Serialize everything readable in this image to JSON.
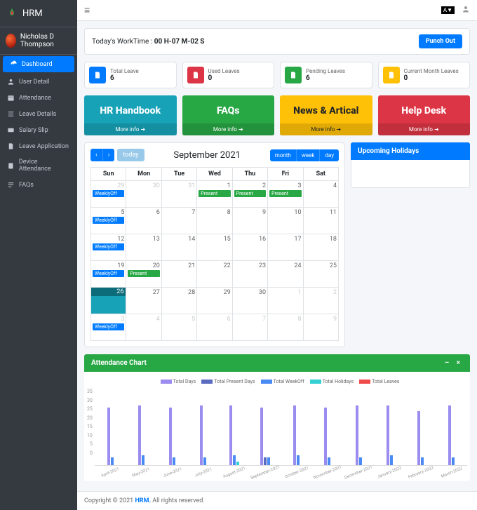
{
  "brand": "HRM",
  "user": {
    "name": "Nicholas D Thompson"
  },
  "nav": [
    {
      "label": "Dashboard",
      "icon": "gauge",
      "active": true
    },
    {
      "label": "User Detail",
      "icon": "user"
    },
    {
      "label": "Attendance",
      "icon": "calendar"
    },
    {
      "label": "Leave Details",
      "icon": "list"
    },
    {
      "label": "Salary Slip",
      "icon": "card"
    },
    {
      "label": "Leave Application",
      "icon": "doc"
    },
    {
      "label": "Device Attendance",
      "icon": "device"
    },
    {
      "label": "FAQs",
      "icon": "faq"
    }
  ],
  "topbar": {
    "menu": "≡",
    "lang": "A▼",
    "user_icon": "👤"
  },
  "worktime": {
    "label": "Today's WorkTime : ",
    "value": "00 H-07 M-02 S",
    "punch": "Punch Out"
  },
  "stats": [
    {
      "title": "Total Leave",
      "value": "6",
      "color": "#007bff"
    },
    {
      "title": "Used Leaves",
      "value": "0",
      "color": "#dc3545"
    },
    {
      "title": "Pending Leaves",
      "value": "6",
      "color": "#28a745"
    },
    {
      "title": "Current Month Leaves",
      "value": "0",
      "color": "#ffc107"
    }
  ],
  "cards": [
    {
      "title": "HR Handbook",
      "more": "More info"
    },
    {
      "title": "FAQs",
      "more": "More info"
    },
    {
      "title": "News & Artical",
      "more": "More info"
    },
    {
      "title": "Help Desk",
      "more": "More info"
    }
  ],
  "calendar": {
    "prev": "‹",
    "next": "›",
    "today": "today",
    "title": "September 2021",
    "views": {
      "month": "month",
      "week": "week",
      "day": "day"
    },
    "days": [
      "Sun",
      "Mon",
      "Tue",
      "Wed",
      "Thu",
      "Fri",
      "Sat"
    ],
    "events": {
      "wo": "WeeklyOff",
      "pr": "Present"
    },
    "grid": [
      [
        {
          "n": 29,
          "o": 1,
          "e": [
            "wo"
          ]
        },
        {
          "n": 30,
          "o": 1
        },
        {
          "n": 31,
          "o": 1
        },
        {
          "n": 1,
          "e": [
            "pr"
          ]
        },
        {
          "n": 2,
          "e": [
            "pr"
          ]
        },
        {
          "n": 3,
          "e": [
            "pr"
          ]
        },
        {
          "n": 4
        }
      ],
      [
        {
          "n": 5,
          "e": [
            "wo"
          ]
        },
        {
          "n": 6
        },
        {
          "n": 7
        },
        {
          "n": 8
        },
        {
          "n": 9
        },
        {
          "n": 10
        },
        {
          "n": 11
        }
      ],
      [
        {
          "n": 12,
          "e": [
            "wo"
          ]
        },
        {
          "n": 13
        },
        {
          "n": 14
        },
        {
          "n": 15
        },
        {
          "n": 16
        },
        {
          "n": 17
        },
        {
          "n": 18
        }
      ],
      [
        {
          "n": 19,
          "e": [
            "wo"
          ]
        },
        {
          "n": 20,
          "e": [
            "pr"
          ]
        },
        {
          "n": 21
        },
        {
          "n": 22
        },
        {
          "n": 23
        },
        {
          "n": 24
        },
        {
          "n": 25
        }
      ],
      [
        {
          "n": 26,
          "t": 1
        },
        {
          "n": 27
        },
        {
          "n": 28
        },
        {
          "n": 29
        },
        {
          "n": 30
        },
        {
          "n": 1,
          "o": 1
        },
        {
          "n": 2,
          "o": 1
        }
      ],
      [
        {
          "n": 3,
          "o": 1,
          "e": [
            "wo"
          ]
        },
        {
          "n": 4,
          "o": 1
        },
        {
          "n": 5,
          "o": 1
        },
        {
          "n": 6,
          "o": 1
        },
        {
          "n": 7,
          "o": 1
        },
        {
          "n": 8,
          "o": 1
        },
        {
          "n": 9,
          "o": 1
        }
      ]
    ]
  },
  "holidays": {
    "title": "Upcoming Holidays"
  },
  "chart": {
    "title": "Attendance Chart",
    "controls": "– ×",
    "legend": [
      {
        "label": "Total Days",
        "color": "#9b8cf0"
      },
      {
        "label": "Total Present Days",
        "color": "#5b6bbf"
      },
      {
        "label": "Total WeekOff",
        "color": "#4a8af5"
      },
      {
        "label": "Total Holidays",
        "color": "#35d0d4"
      },
      {
        "label": "Total Leaves",
        "color": "#f04b4b"
      }
    ]
  },
  "chart_data": {
    "type": "bar",
    "title": "Attendance Chart",
    "ylabel": "",
    "xlabel": "",
    "ylim": [
      0,
      35
    ],
    "yticks": [
      0,
      5,
      10,
      15,
      20,
      25,
      30,
      35
    ],
    "categories": [
      "April-2021",
      "May-2021",
      "June-2021",
      "July-2021",
      "August-2021",
      "September-2021",
      "October-2021",
      "November-2021",
      "December-2021",
      "January-2022",
      "February-2022",
      "March-2022"
    ],
    "series": [
      {
        "name": "Total Days",
        "color": "#9b8cf0",
        "values": [
          30,
          31,
          30,
          31,
          31,
          30,
          31,
          30,
          31,
          31,
          28,
          31
        ]
      },
      {
        "name": "Total Present Days",
        "color": "#5b6bbf",
        "values": [
          0,
          0,
          0,
          0,
          0,
          4,
          0,
          0,
          0,
          0,
          0,
          0
        ]
      },
      {
        "name": "Total WeekOff",
        "color": "#4a8af5",
        "values": [
          4,
          5,
          4,
          4,
          5,
          4,
          5,
          4,
          4,
          5,
          4,
          4
        ]
      },
      {
        "name": "Total Holidays",
        "color": "#35d0d4",
        "values": [
          0,
          0,
          0,
          0,
          2,
          0,
          0,
          0,
          0,
          0,
          0,
          0
        ]
      },
      {
        "name": "Total Leaves",
        "color": "#f04b4b",
        "values": [
          0,
          0,
          0,
          0,
          0,
          0,
          0,
          0,
          0,
          0,
          0,
          0
        ]
      }
    ]
  },
  "footer": {
    "pre": "Copyright © 2021 ",
    "brand": "HRM.",
    "post": " All rights reserved."
  }
}
